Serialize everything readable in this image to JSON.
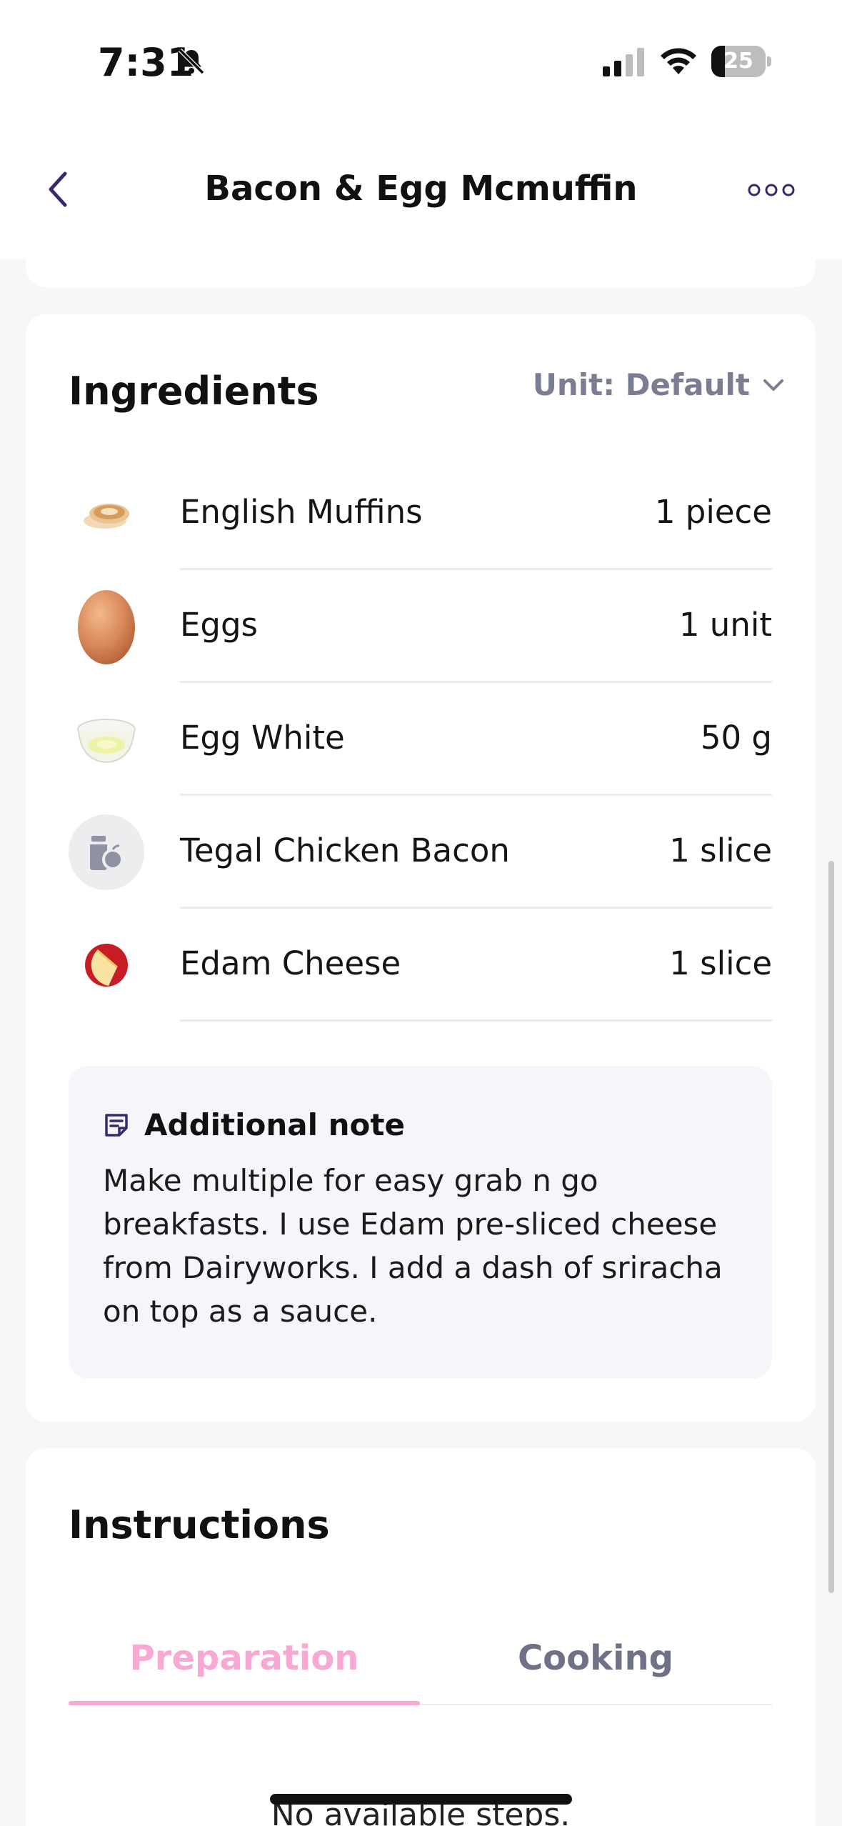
{
  "status_bar": {
    "time": "7:31",
    "battery": "25",
    "battery_level_percent": 25,
    "icons": [
      "bell-slash-icon",
      "signal-icon",
      "wifi-icon",
      "battery-icon"
    ]
  },
  "header": {
    "title": "Bacon & Egg Mcmuffin",
    "back_icon": "chevron-left-icon",
    "more_icon": "more-horizontal-icon"
  },
  "ingredients": {
    "title": "Ingredients",
    "unit_label": "Unit: Default",
    "items": [
      {
        "name": "English Muffins",
        "qty": "1 piece",
        "icon": "english-muffin-icon"
      },
      {
        "name": "Eggs",
        "qty": "1 unit",
        "icon": "egg-icon"
      },
      {
        "name": "Egg White",
        "qty": "50 g",
        "icon": "egg-white-bowl-icon"
      },
      {
        "name": "Tegal Chicken Bacon",
        "qty": "1 slice",
        "icon": "generic-food-icon"
      },
      {
        "name": "Edam Cheese",
        "qty": "1 slice",
        "icon": "edam-cheese-icon"
      }
    ],
    "note": {
      "title": "Additional note",
      "text": "Make multiple for easy grab n go breakfasts. I use Edam pre-sliced cheese from Dairyworks. I add a dash of sriracha on top as a sauce."
    }
  },
  "instructions": {
    "title": "Instructions",
    "tabs": [
      {
        "label": "Preparation",
        "active": true
      },
      {
        "label": "Cooking",
        "active": false
      }
    ],
    "empty_message": "No available steps."
  },
  "colors": {
    "accent_pink": "#f7a8d3",
    "muted_text": "#7b7e93",
    "note_bg": "#f5f6fa",
    "page_bg": "#f7f7f8",
    "back_icon": "#3b2a6b"
  }
}
